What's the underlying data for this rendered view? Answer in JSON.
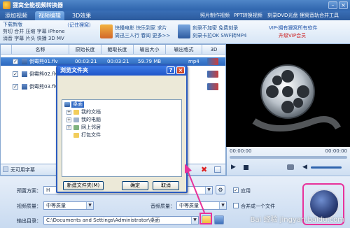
{
  "window": {
    "title": "狸窝全能视频转换器",
    "minimize": "–",
    "close": "×"
  },
  "tabs": [
    {
      "label": "添加视频",
      "active": false
    },
    {
      "label": "视频编辑",
      "active": true
    },
    {
      "label": "3D效果",
      "active": false
    }
  ],
  "top_links": [
    "照片制作视频",
    "PPT转换视频",
    "刻录DVD光盘",
    "狸窝音轨合并工具"
  ],
  "banner": {
    "new_version": "下载新版",
    "features_line1": "剪切 合并 压缩 字幕 iPhone",
    "features_line2": "消音 字幕 片头 快播 3D MV",
    "remember_link": "（记住狸窝）",
    "promo1_line1": "快播电影 快乐到家 求片",
    "promo1_line2": "周迅三人行 春闺 更多>>",
    "promo2_line1": "刻录不加密 免费刻录",
    "promo2_line2": "刻录卡拉OK SWF转MP4",
    "vip_line1": "VIP-拥有狸窝所有软件",
    "vip_line2": "升级VIP会员"
  },
  "grid": {
    "headers": [
      "名称",
      "原始长度",
      "截取长度",
      "输出大小",
      "输出格式",
      "3D"
    ],
    "rows": [
      {
        "name": "倒霉熊01.flv",
        "orig": "00:03:21",
        "cut": "00:03:21",
        "size": "59.79 MB",
        "format": "mp4",
        "checked": true
      },
      {
        "name": "倒霉熊02.flv",
        "orig": "00:03:21",
        "cut": "00:03:21",
        "size": "",
        "format": "",
        "checked": true
      },
      {
        "name": "倒霉熊03.flv",
        "orig": "",
        "cut": "",
        "size": "",
        "format": "",
        "checked": true
      }
    ],
    "subtitle": "无可用字幕"
  },
  "player": {
    "time_left": "00:00:00",
    "time_right": "00:00:00"
  },
  "bottom": {
    "preset_label": "预置方案：",
    "preset_value": "H",
    "video_quality_label": "视频质量：",
    "video_quality_value": "中等质量",
    "audio_quality_label": "音频质量：",
    "audio_quality_value": "中等质量",
    "output_label": "输出目录：",
    "output_path": "C:\\Documents and Settings\\Administrator\\桌面",
    "apply_all": "应用",
    "merge": "合并成一个文件"
  },
  "dialog": {
    "title": "浏览文件夹",
    "help": "?",
    "close": "×",
    "tree": [
      {
        "label": "桌面",
        "level": 0,
        "selected": true,
        "expander": ""
      },
      {
        "label": "我的文档",
        "level": 1,
        "expander": "+"
      },
      {
        "label": "我的电脑",
        "level": 1,
        "expander": "+"
      },
      {
        "label": "网上邻居",
        "level": 1,
        "expander": "+"
      },
      {
        "label": "打包文件",
        "level": 1,
        "expander": ""
      }
    ],
    "new_folder": "新建文件夹(M)",
    "ok": "确定",
    "cancel": "取消"
  },
  "watermark": "Bai 经验 jingyan.baidu.com",
  "colors": {
    "accent": "#2f64ad",
    "highlight": "#e8329b",
    "dialog_title": "#1f55c9"
  }
}
